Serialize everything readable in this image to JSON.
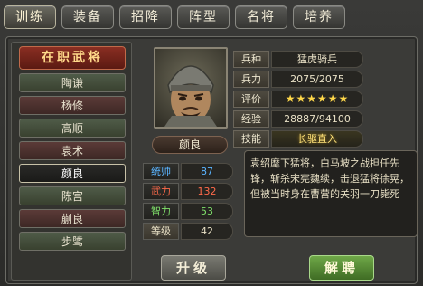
{
  "tabs": [
    {
      "label": "训练"
    },
    {
      "label": "装备"
    },
    {
      "label": "招降"
    },
    {
      "label": "阵型"
    },
    {
      "label": "名将"
    },
    {
      "label": "培养"
    }
  ],
  "sidebar": {
    "title": "在职武将",
    "items": [
      {
        "label": "陶谦",
        "style": "green"
      },
      {
        "label": "杨修",
        "style": "red"
      },
      {
        "label": "高顺",
        "style": "green"
      },
      {
        "label": "袁术",
        "style": "red"
      },
      {
        "label": "颜良",
        "style": "sel"
      },
      {
        "label": "陈宫",
        "style": "green"
      },
      {
        "label": "蒯良",
        "style": "red"
      },
      {
        "label": "步骘",
        "style": "green"
      }
    ]
  },
  "general": {
    "name": "颜良",
    "info": [
      {
        "label": "兵种",
        "value": "猛虎骑兵"
      },
      {
        "label": "兵力",
        "value": "2075/2075"
      },
      {
        "label": "评价",
        "value": "★★★★★★"
      },
      {
        "label": "经验",
        "value": "28887/94100"
      },
      {
        "label": "技能",
        "value": "长驱直入"
      }
    ],
    "stats": [
      {
        "label": "统帅",
        "value": "87",
        "color": "#5ab4ff"
      },
      {
        "label": "武力",
        "value": "132",
        "color": "#ff6a4a"
      },
      {
        "label": "智力",
        "value": "53",
        "color": "#7fe06a"
      },
      {
        "label": "等级",
        "value": "42",
        "color": "#e9e1c6"
      }
    ],
    "bio": "袁绍麾下猛将，白马坡之战担任先锋，斩杀宋宪魏续，击退猛将徐晃，但被当时身在曹营的关羽一刀毙死"
  },
  "buttons": {
    "upgrade": "升级",
    "dismiss": "解聘"
  }
}
